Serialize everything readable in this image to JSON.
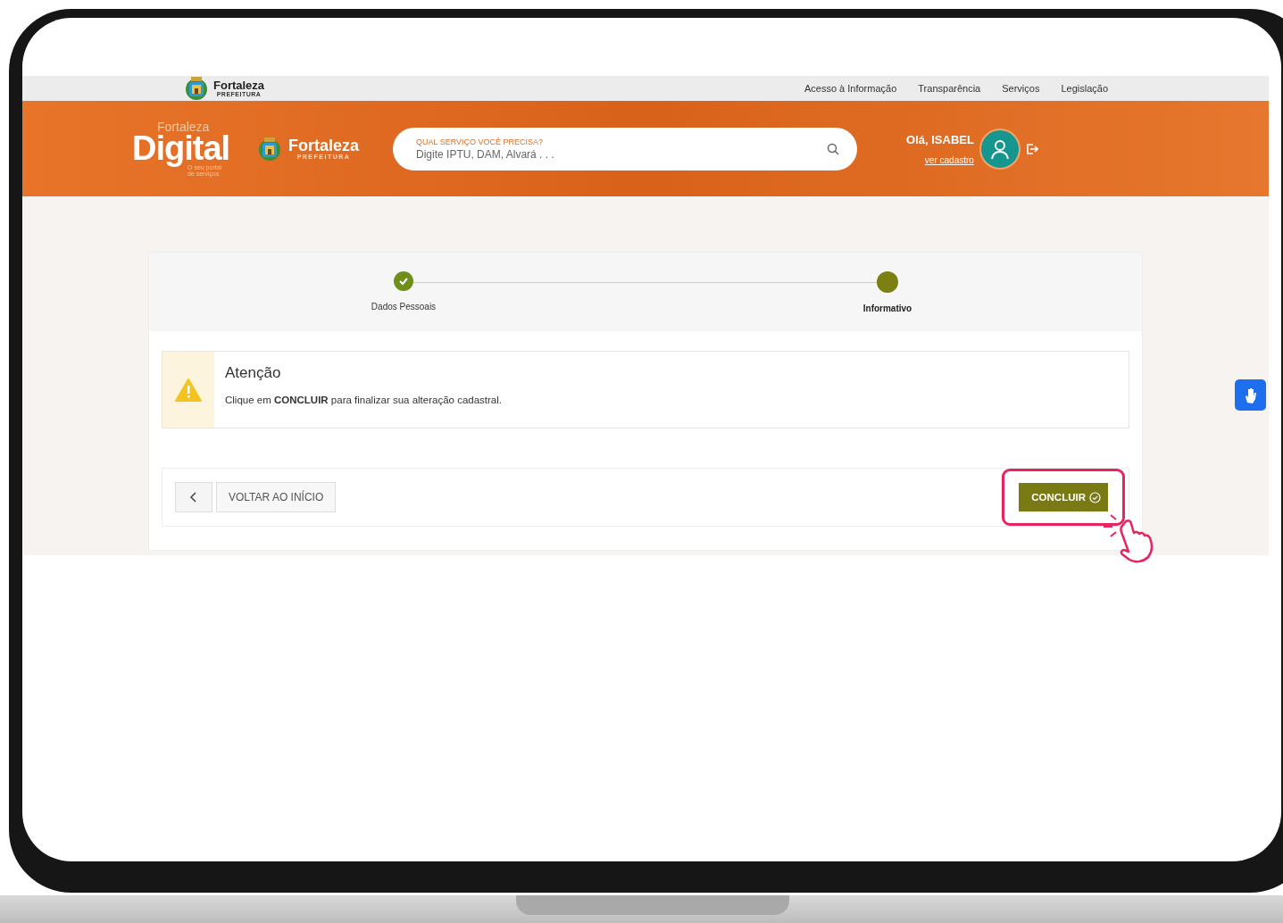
{
  "top_bar": {
    "logo": {
      "name": "Fortaleza",
      "subtitle": "PREFEITURA"
    },
    "links": [
      "Acesso à Informação",
      "Transparência",
      "Serviços",
      "Legislação"
    ]
  },
  "header": {
    "brand": {
      "line1": "Fortaleza",
      "line2": "Digital",
      "tagline": "O seu portal de serviços"
    },
    "city_logo": {
      "name": "Fortaleza",
      "subtitle": "PREFEITURA"
    },
    "search": {
      "label": "QUAL SERVIÇO VOCÊ PRECISA?",
      "placeholder": "Digite IPTU, DAM, Alvará . . ."
    },
    "user": {
      "greeting": "Olá, ISABEL",
      "link": "ver cadastro"
    }
  },
  "steps": [
    {
      "label": "Dados Pessoais",
      "completed": true,
      "selected": false
    },
    {
      "label": "Informativo",
      "completed": false,
      "selected": true
    }
  ],
  "alert": {
    "title": "Atenção",
    "message": "Clique em **CONCLUIR** para finalizar sua alteração cadastral."
  },
  "actions": {
    "back": "VOLTAR AO INÍCIO",
    "confirm": "CONCLUIR",
    "confirm_highlighted": true
  }
}
